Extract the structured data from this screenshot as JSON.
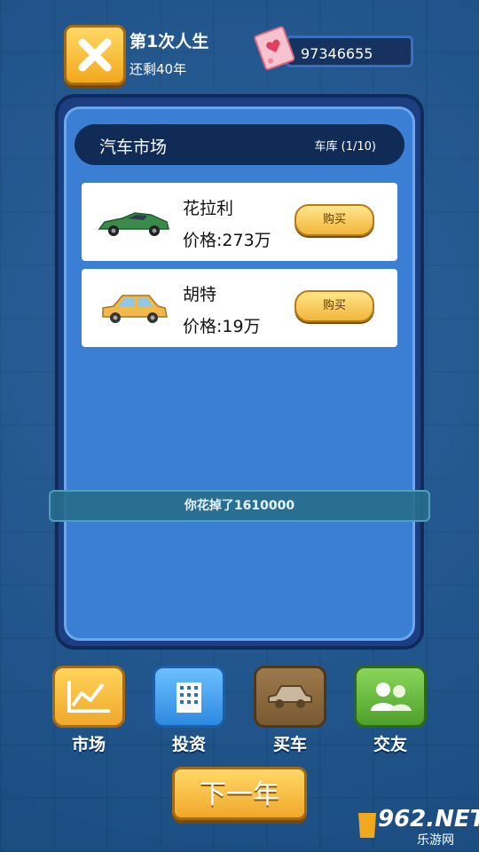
{
  "header": {
    "title": "第1次人生",
    "subtitle": "还剩40年",
    "money": "97346655"
  },
  "market": {
    "title": "汽车市场",
    "garage": "车库 (1/10)",
    "cars": [
      {
        "name": "花拉利",
        "price": "价格:273万",
        "buy_label": "购买",
        "icon": "green-sports-car-icon",
        "color": "#3a8a4a"
      },
      {
        "name": "胡特",
        "price": "价格:19万",
        "buy_label": "购买",
        "icon": "yellow-hatchback-icon",
        "color": "#f2b84a"
      }
    ]
  },
  "toast": "你花掉了1610000",
  "nav": [
    {
      "label": "市场",
      "icon": "chart-icon",
      "color": "#f5b52e"
    },
    {
      "label": "投资",
      "icon": "building-icon",
      "color": "#4aa5ee"
    },
    {
      "label": "买车",
      "icon": "car-icon",
      "color": "#8c6a3e"
    },
    {
      "label": "交友",
      "icon": "friends-icon",
      "color": "#6ac04a"
    }
  ],
  "next_label": "下一年",
  "watermark": {
    "brand": "962.NET",
    "sub": "乐游网"
  }
}
